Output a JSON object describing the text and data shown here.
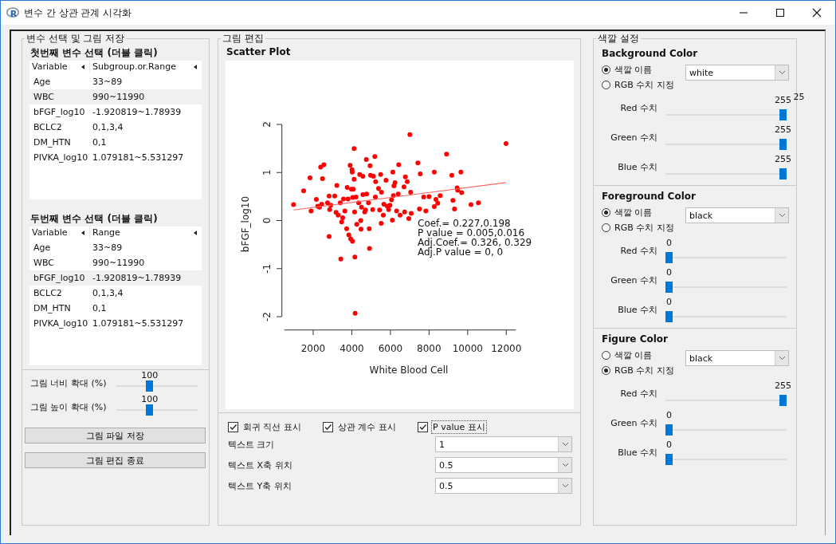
{
  "window": {
    "title": "변수 간 상관 관계 시각화",
    "app_icon_letter": "R"
  },
  "variable_panel": {
    "title": "변수 선택 및 그림 저장",
    "tables": [
      {
        "heading": "첫번째 변수 선택 (더블 클릭)",
        "columns": [
          "Variable",
          "Subgroup.or.Range"
        ],
        "rows": [
          {
            "cells": [
              "Age",
              "33~89"
            ],
            "selected": false
          },
          {
            "cells": [
              "WBC",
              "990~11990"
            ],
            "selected": true
          },
          {
            "cells": [
              "bFGF_log10",
              "-1.920819~1.78939"
            ],
            "selected": false
          },
          {
            "cells": [
              "BCLC2",
              "0,1,3,4"
            ],
            "selected": false
          },
          {
            "cells": [
              "DM_HTN",
              "0,1"
            ],
            "selected": false
          },
          {
            "cells": [
              "PIVKA_log10",
              "1.079181~5.531297"
            ],
            "selected": false
          }
        ]
      },
      {
        "heading": "두번째 변수 선택 (더블 클릭)",
        "columns": [
          "Variable",
          "Range"
        ],
        "rows": [
          {
            "cells": [
              "Age",
              "33~89"
            ],
            "selected": false
          },
          {
            "cells": [
              "WBC",
              "990~11990"
            ],
            "selected": false
          },
          {
            "cells": [
              "bFGF_log10",
              "-1.920819~1.78939"
            ],
            "selected": true
          },
          {
            "cells": [
              "BCLC2",
              "0,1,3,4"
            ],
            "selected": false
          },
          {
            "cells": [
              "DM_HTN",
              "0,1"
            ],
            "selected": false
          },
          {
            "cells": [
              "PIVKA_log10",
              "1.079181~5.531297"
            ],
            "selected": false
          }
        ]
      }
    ],
    "sliders": [
      {
        "label": "그림 너비 확대 (%)",
        "value": "100",
        "level": 0.4
      },
      {
        "label": "그림 높이 확대 (%)",
        "value": "100",
        "level": 0.4
      }
    ],
    "buttons": [
      "그림 파일 저장",
      "그림 편집 종료"
    ]
  },
  "edit_panel": {
    "title": "그림 편집",
    "plot_title": "Scatter Plot",
    "chart_data": {
      "type": "scatter",
      "xlabel": "White Blood Cell",
      "ylabel": "bFGF_log10",
      "xticks": [
        {
          "value": 2000,
          "label": "2000"
        },
        {
          "value": 4000,
          "label": "4000"
        },
        {
          "value": 6000,
          "label": "6000"
        },
        {
          "value": 8000,
          "label": "8000"
        },
        {
          "value": 10000,
          "label": "10000"
        },
        {
          "value": 12000,
          "label": "12000"
        }
      ],
      "yticks": [
        {
          "value": -2,
          "label": "-2"
        },
        {
          "value": -1,
          "label": "-1"
        },
        {
          "value": 0,
          "label": "0"
        },
        {
          "value": 1,
          "label": "1"
        },
        {
          "value": 2,
          "label": "2"
        }
      ],
      "x": [
        982,
        1505,
        1835,
        1890,
        2165,
        2234,
        2385,
        2550,
        2481,
        2440,
        2330,
        2743,
        2825,
        2853,
        2908,
        2825,
        3114,
        3224,
        3183,
        3293,
        3403,
        3430,
        3472,
        3527,
        3568,
        3637,
        3733,
        3761,
        3802,
        3843,
        3912,
        3940,
        3981,
        4008,
        4022,
        4036,
        4050,
        4077,
        4118,
        4118,
        4146,
        4160,
        4173,
        4215,
        4256,
        4352,
        4407,
        4462,
        4476,
        4503,
        4572,
        4572,
        4668,
        4710,
        4751,
        4765,
        4861,
        4902,
        4916,
        4944,
        4971,
        5081,
        5122,
        5191,
        5219,
        5233,
        5384,
        5439,
        5494,
        5521,
        5535,
        5631,
        5659,
        5769,
        5838,
        5906,
        5975,
        6058,
        6099,
        6126,
        6154,
        6181,
        6236,
        6319,
        6401,
        6429,
        6498,
        6704,
        6732,
        6773,
        6869,
        6952,
        7007,
        7048,
        7076,
        7420,
        7502,
        7543,
        7722,
        7832,
        7997,
        8272,
        8355,
        8451,
        8575,
        8272,
        8905,
        9180,
        9235,
        9317,
        9455,
        9483,
        9648,
        9689,
        10171,
        10556,
        11986
      ],
      "series": [
        {
          "type": "scatter",
          "color": "#ff0000",
          "values": [
            0.33,
            0.62,
            0.89,
            0.2,
            0.44,
            0.3,
            1.11,
            1.16,
            0.87,
            0.34,
            0.28,
            0.37,
            0.51,
            0.23,
            0.32,
            -0.33,
            0.51,
            0.73,
            0.17,
            0.11,
            0.37,
            -0.8,
            -0.03,
            0.06,
            0.45,
            0.2,
            -0.17,
            0.69,
            0.45,
            -0.3,
            1.15,
            -0.38,
            0.65,
            1.06,
            1.01,
            -0.43,
            0.48,
            0.65,
            1.5,
            0.86,
            0.18,
            -0.76,
            -1.93,
            0.49,
            -0.08,
            0.37,
            0.96,
            0.0,
            -0.18,
            0.28,
            0.92,
            0.54,
            0.18,
            0.22,
            1.27,
            0.55,
            0.37,
            -0.17,
            -0.58,
            1.14,
            0.94,
            0.23,
            0.92,
            1.33,
            0.49,
            0.81,
            0.67,
            0.22,
            0.96,
            -0.06,
            0.59,
            0.11,
            0.34,
            0.84,
            0.3,
            0.23,
            0.32,
            0.43,
            0.01,
            1.01,
            0.52,
            0.72,
            0.79,
            0.2,
            0.55,
            1.16,
            0.11,
            0.7,
            0.18,
            0.91,
            0.81,
            0.04,
            1.79,
            0.59,
            0.15,
            1.2,
            0.24,
            0.97,
            0.49,
            0.2,
            0.5,
            1.01,
            0.44,
            0.36,
            0.52,
            0.29,
            1.38,
            0.94,
            0.42,
            0.24,
            0.68,
            0.63,
            1.01,
            0.58,
            0.33,
            0.37,
            1.6
          ]
        },
        {
          "type": "line",
          "color": "#ff6464",
          "values": [
            0.22,
            null,
            null,
            null,
            null,
            null,
            null,
            null,
            null,
            null,
            null,
            null,
            null,
            null,
            null,
            null,
            null,
            null,
            null,
            null,
            null,
            null,
            null,
            null,
            null,
            null,
            null,
            null,
            null,
            null,
            null,
            null,
            null,
            null,
            null,
            null,
            null,
            null,
            null,
            null,
            null,
            null,
            null,
            null,
            null,
            null,
            null,
            null,
            null,
            null,
            null,
            null,
            null,
            null,
            null,
            null,
            null,
            null,
            null,
            null,
            null,
            null,
            null,
            null,
            null,
            null,
            null,
            null,
            null,
            null,
            null,
            null,
            null,
            null,
            null,
            null,
            null,
            null,
            null,
            null,
            null,
            null,
            null,
            null,
            null,
            null,
            null,
            null,
            null,
            null,
            null,
            null,
            null,
            null,
            null,
            null,
            null,
            null,
            null,
            null,
            null,
            null,
            null,
            null,
            null,
            null,
            null,
            null,
            null,
            null,
            null,
            null,
            null,
            null,
            null,
            null,
            0.79
          ]
        }
      ],
      "xlim": [
        500,
        12500
      ],
      "ylim": [
        -2,
        2
      ],
      "annotations": [
        "Coef.= 0.227,0.198",
        "P value = 0.005,0.016",
        "Adj.Coef.= 0.326, 0.329",
        "Adj.P value = 0, 0"
      ]
    },
    "checkboxes": [
      {
        "label": "회귀 직선 표시",
        "checked": true,
        "focused": false
      },
      {
        "label": "상관 계수 표시",
        "checked": true,
        "focused": false
      },
      {
        "label": "P value 표시",
        "checked": true,
        "focused": true
      }
    ],
    "options": [
      {
        "label": "텍스트 크기",
        "value": "1"
      },
      {
        "label": "텍스트 X축 위치",
        "value": "0.5"
      },
      {
        "label": "텍스트 Y축 위치",
        "value": "0.5"
      }
    ]
  },
  "color_panel": {
    "title": "색깔 설정",
    "sections": [
      {
        "title": "Background Color",
        "radios": [
          {
            "label": "색깔 이름",
            "selected": true
          },
          {
            "label": "RGB 수치 지정",
            "selected": false
          }
        ],
        "color_name": "white",
        "sliders": [
          {
            "label": "Red 수치",
            "value": "255",
            "level": 1,
            "overflow_text": "25"
          },
          {
            "label": "Green 수치",
            "value": "255",
            "level": 1
          },
          {
            "label": "Blue 수치",
            "value": "255",
            "level": 1
          }
        ]
      },
      {
        "title": "Foreground Color",
        "radios": [
          {
            "label": "색깔 이름",
            "selected": true
          },
          {
            "label": "RGB 수치 지정",
            "selected": false
          }
        ],
        "color_name": "black",
        "sliders": [
          {
            "label": "Red 수치",
            "value": "0",
            "level": 0
          },
          {
            "label": "Green 수치",
            "value": "0",
            "level": 0
          },
          {
            "label": "Blue 수치",
            "value": "0",
            "level": 0
          }
        ]
      },
      {
        "title": "Figure Color",
        "radios": [
          {
            "label": "색깔 이름",
            "selected": false
          },
          {
            "label": "RGB 수치 지정",
            "selected": true
          }
        ],
        "color_name": "black",
        "sliders": [
          {
            "label": "Red 수치",
            "value": "255",
            "level": 1
          },
          {
            "label": "Green 수치",
            "value": "0",
            "level": 0
          },
          {
            "label": "Blue 수치",
            "value": "0",
            "level": 0
          }
        ]
      }
    ]
  }
}
